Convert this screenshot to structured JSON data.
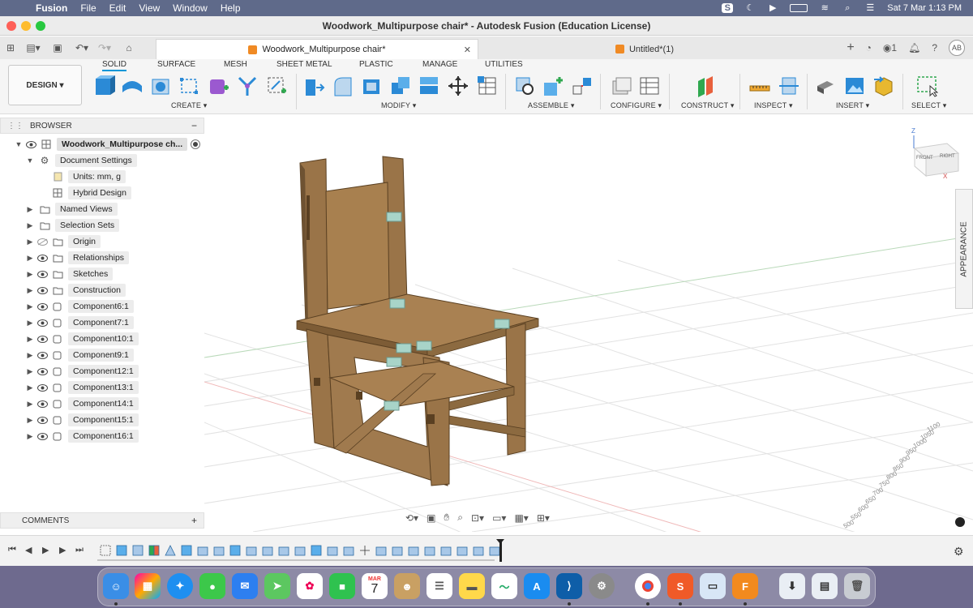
{
  "menubar": {
    "app_name": "Fusion",
    "items": [
      "File",
      "Edit",
      "View",
      "Window",
      "Help"
    ],
    "datetime": "Sat 7 Mar  1:13 PM"
  },
  "window": {
    "title": "Woodwork_Multipurpose chair* - Autodesk Fusion (Education License)"
  },
  "tabs": {
    "active": "Woodwork_Multipurpose chair*",
    "inactive": "Untitled*(1)",
    "job_count": "1",
    "user_initials": "AB"
  },
  "toolbar": {
    "workspace": "DESIGN",
    "workspace_tabs": [
      "SOLID",
      "SURFACE",
      "MESH",
      "SHEET METAL",
      "PLASTIC",
      "MANAGE",
      "UTILITIES"
    ],
    "groups": {
      "create": "CREATE",
      "modify": "MODIFY",
      "assemble": "ASSEMBLE",
      "configure": "CONFIGURE",
      "construct": "CONSTRUCT",
      "inspect": "INSPECT",
      "insert": "INSERT",
      "select": "SELECT"
    }
  },
  "browser": {
    "title": "BROWSER",
    "root": "Woodwork_Multipurpose ch...",
    "items": [
      {
        "label": "Document Settings"
      },
      {
        "label": "Units: mm, g"
      },
      {
        "label": "Hybrid Design"
      },
      {
        "label": "Named Views"
      },
      {
        "label": "Selection Sets"
      },
      {
        "label": "Origin"
      },
      {
        "label": "Relationships"
      },
      {
        "label": "Sketches"
      },
      {
        "label": "Construction"
      },
      {
        "label": "Component6:1"
      },
      {
        "label": "Component7:1"
      },
      {
        "label": "Component10:1"
      },
      {
        "label": "Component9:1"
      },
      {
        "label": "Component12:1"
      },
      {
        "label": "Component13:1"
      },
      {
        "label": "Component14:1"
      },
      {
        "label": "Component15:1"
      },
      {
        "label": "Component16:1"
      }
    ]
  },
  "comments": {
    "title": "COMMENTS"
  },
  "viewcube": {
    "front": "FRONT",
    "right": "RIGHT",
    "z": "Z",
    "x": "X"
  },
  "appearance_panel": "APPEARANCE",
  "ruler": {
    "ticks": [
      "1100",
      "1050",
      "1000",
      "950",
      "900",
      "850",
      "800",
      "750",
      "700",
      "650",
      "600",
      "550",
      "500",
      "450",
      "400",
      "350",
      "300"
    ]
  },
  "colors": {
    "accent": "#0696d7",
    "wood": "#a07a4e",
    "macos_menubar": "#5f6a8a",
    "dock_bg": "#6e6a8e"
  },
  "dock": {
    "calendar_month": "MAR",
    "calendar_day": "7"
  }
}
